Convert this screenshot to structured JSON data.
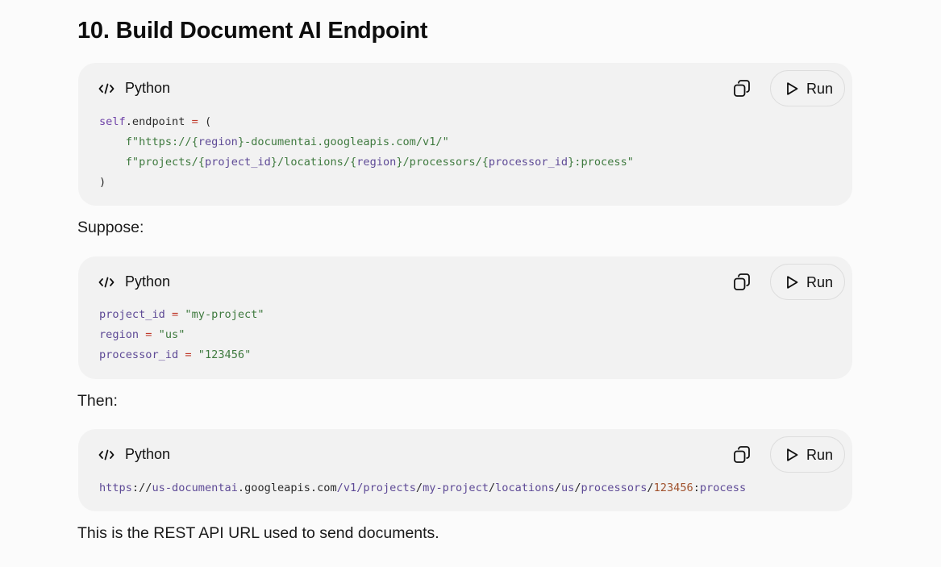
{
  "heading": "10. Build Document AI Endpoint",
  "blocks": [
    {
      "language": "Python",
      "run_label": "Run",
      "lines": [
        [
          [
            "self",
            "kw"
          ],
          [
            ".endpoint ",
            "pun"
          ],
          [
            "=",
            "op"
          ],
          [
            " (",
            "pun"
          ]
        ],
        [
          [
            "    f\"https://{",
            "str"
          ],
          [
            "region",
            "var"
          ],
          [
            "}-documentai.googleapis.com/v1/\"",
            "str"
          ]
        ],
        [
          [
            "    f\"projects/{",
            "str"
          ],
          [
            "project_id",
            "var"
          ],
          [
            "}/locations/{",
            "str"
          ],
          [
            "region",
            "var"
          ],
          [
            "}/processors/{",
            "str"
          ],
          [
            "processor_id",
            "var"
          ],
          [
            "}:process\"",
            "str"
          ]
        ],
        [
          [
            ")",
            "pun"
          ]
        ]
      ]
    },
    {
      "language": "Python",
      "run_label": "Run",
      "lines": [
        [
          [
            "project_id ",
            "var"
          ],
          [
            "=",
            "op"
          ],
          [
            " \"my-project\"",
            "str"
          ]
        ],
        [
          [
            "region ",
            "var"
          ],
          [
            "=",
            "op"
          ],
          [
            " \"us\"",
            "str"
          ]
        ],
        [
          [
            "processor_id ",
            "var"
          ],
          [
            "=",
            "op"
          ],
          [
            " \"123456\"",
            "str"
          ]
        ]
      ]
    },
    {
      "language": "Python",
      "run_label": "Run",
      "lines": [
        [
          [
            "https",
            "var"
          ],
          [
            "://",
            "pun"
          ],
          [
            "us-documentai",
            "var"
          ],
          [
            ".",
            "pun"
          ],
          [
            "googleapis",
            "pun"
          ],
          [
            ".",
            "pun"
          ],
          [
            "com",
            "pun"
          ],
          [
            "/v1/",
            "var"
          ],
          [
            "projects",
            "var"
          ],
          [
            "/",
            "pun"
          ],
          [
            "my-project",
            "var"
          ],
          [
            "/",
            "pun"
          ],
          [
            "locations",
            "var"
          ],
          [
            "/",
            "pun"
          ],
          [
            "us",
            "var"
          ],
          [
            "/",
            "pun"
          ],
          [
            "processors",
            "var"
          ],
          [
            "/",
            "pun"
          ],
          [
            "123456",
            "num"
          ],
          [
            ":",
            "pun"
          ],
          [
            "process",
            "var"
          ]
        ]
      ]
    }
  ],
  "paragraphs": {
    "suppose": "Suppose:",
    "then": "Then:",
    "closing": "This is the REST API URL used to send documents."
  }
}
